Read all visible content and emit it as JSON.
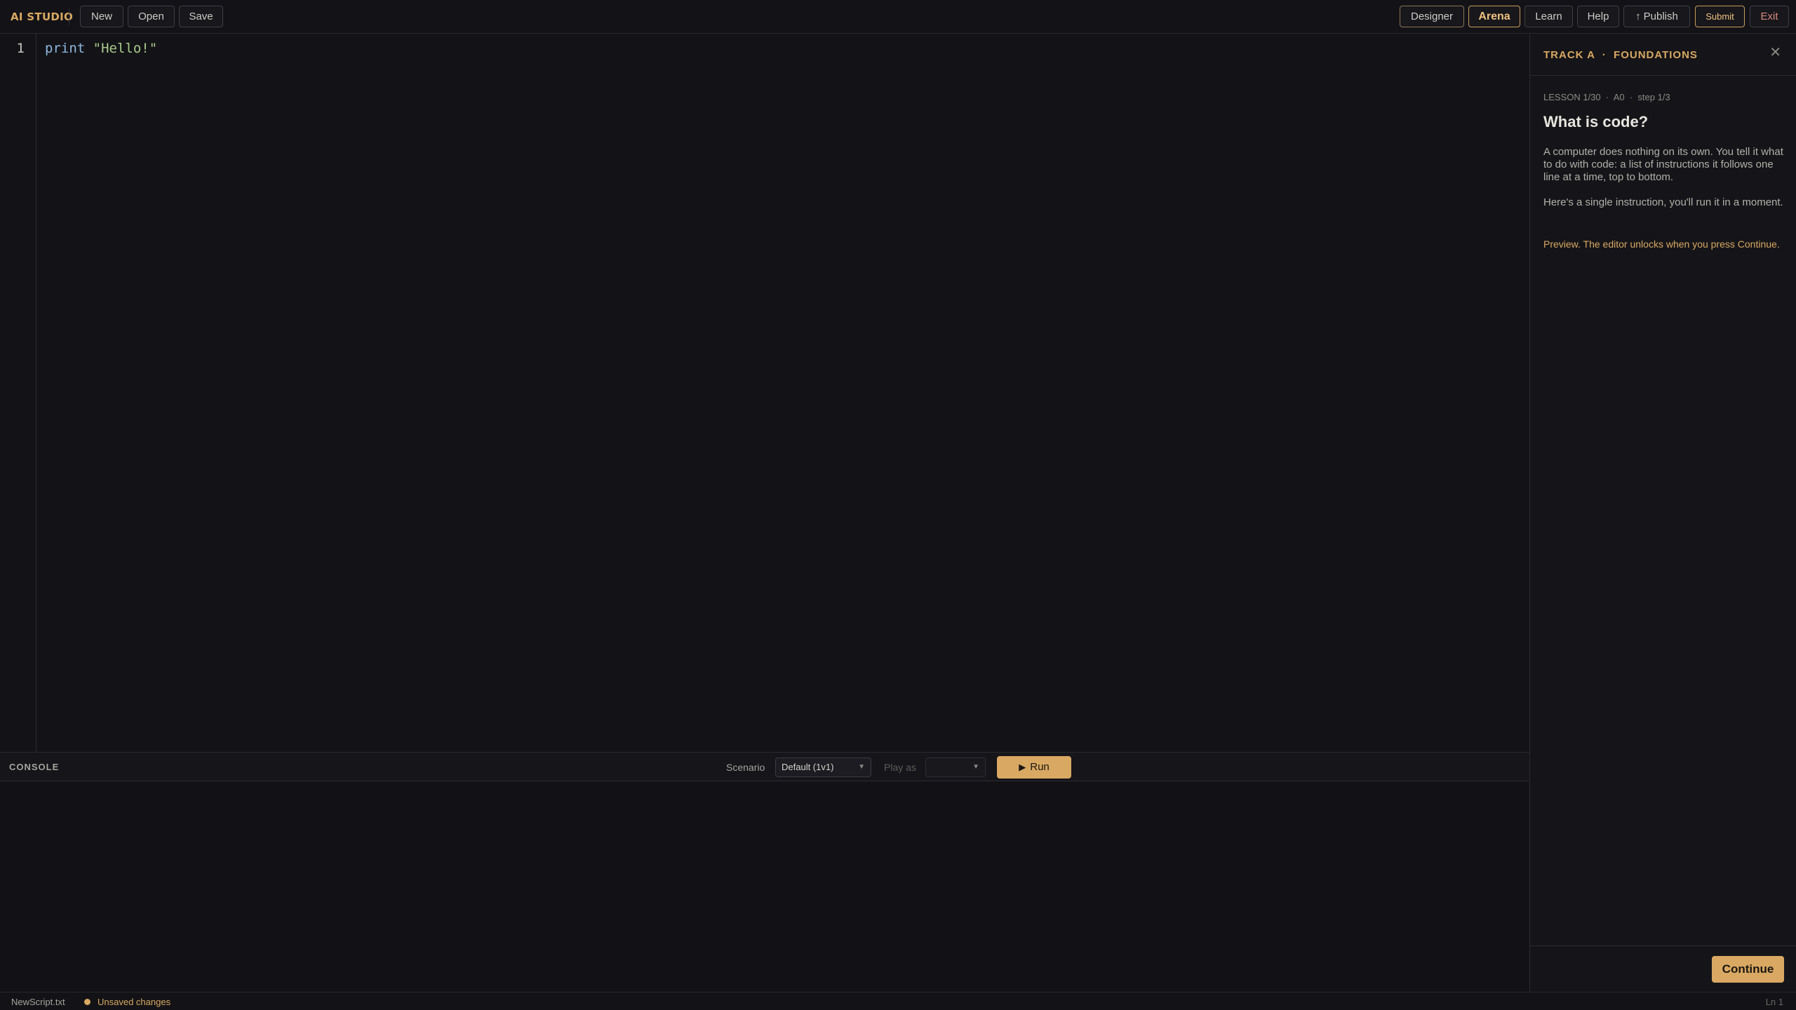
{
  "app": {
    "brand": "AI STUDIO"
  },
  "toolbar": {
    "left": [
      {
        "id": "new",
        "label": "New"
      },
      {
        "id": "open",
        "label": "Open"
      },
      {
        "id": "save",
        "label": "Save"
      }
    ],
    "right": {
      "designer": "Designer",
      "arena": "Arena",
      "learn": "Learn",
      "help": "Help",
      "publish": "Publish",
      "publish_icon": "↑",
      "submit": "Submit",
      "exit": "Exit"
    },
    "active_tab": "Arena"
  },
  "editor": {
    "lines": [
      {
        "number": "1",
        "keyword": "print",
        "string": "\"Hello!\""
      }
    ]
  },
  "console": {
    "title": "CONSOLE",
    "scenario_label": "Scenario",
    "scenario_value": "Default (1v1)",
    "play_as_label": "Play as",
    "play_as_value": "",
    "run_label": "Run",
    "run_icon": "▶"
  },
  "lesson": {
    "track": "TRACK A  ·  FOUNDATIONS",
    "close_icon": "✕",
    "meta": "LESSON 1/30  ·  A0  ·  step 1/3",
    "title": "What is code?",
    "paragraphs": [
      "A computer does nothing on its own. You tell it what to do with code: a list of instructions it follows one line at a time, top to bottom.",
      "Here's a single instruction, you'll run it in a moment."
    ],
    "preview_note": "Preview. The editor unlocks when you press Continue.",
    "continue_label": "Continue"
  },
  "status": {
    "file": "NewScript.txt",
    "unsaved": "Unsaved changes",
    "position": "Ln 1"
  },
  "colors": {
    "accent": "#d9a862",
    "background": "#121216",
    "keyword": "#8fb8e0",
    "string": "#a9c98a",
    "exit": "#d98a7c"
  }
}
